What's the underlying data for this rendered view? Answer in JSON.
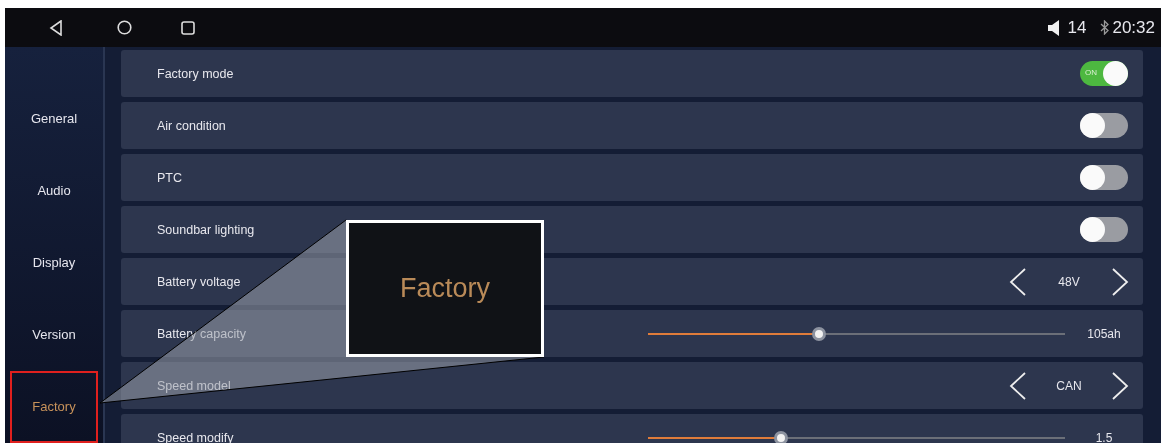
{
  "status_bar": {
    "volume": "14",
    "time": "20:32"
  },
  "sidebar": {
    "items": [
      {
        "label": "General",
        "selected": false
      },
      {
        "label": "Audio",
        "selected": false
      },
      {
        "label": "Display",
        "selected": false
      },
      {
        "label": "Version",
        "selected": false
      },
      {
        "label": "Factory",
        "selected": true,
        "highlighted": true
      }
    ]
  },
  "settings": [
    {
      "kind": "toggle",
      "label": "Factory mode",
      "on": true,
      "on_text": "ON"
    },
    {
      "kind": "toggle",
      "label": "Air condition",
      "on": false
    },
    {
      "kind": "toggle",
      "label": "PTC",
      "on": false
    },
    {
      "kind": "toggle",
      "label": "Soundbar lighting",
      "on": false
    },
    {
      "kind": "stepper",
      "label": "Battery voltage",
      "value": "48V"
    },
    {
      "kind": "slider",
      "label": "Battery capacity",
      "level": 0.41,
      "reading": "105ah"
    },
    {
      "kind": "stepper",
      "label": "Speed model",
      "value": "CAN"
    },
    {
      "kind": "slider",
      "label": "Speed modify",
      "level": 0.32,
      "reading": "1.5"
    }
  ],
  "callout": {
    "text": "Factory"
  }
}
